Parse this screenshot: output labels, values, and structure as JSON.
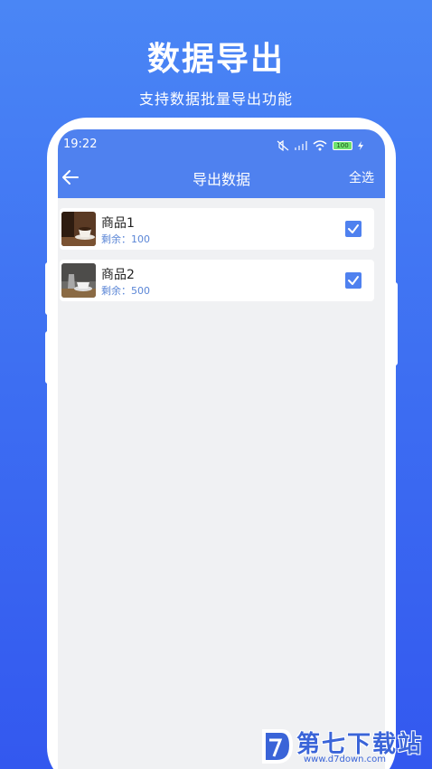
{
  "promo": {
    "title": "数据导出",
    "subtitle": "支持数据批量导出功能"
  },
  "status_bar": {
    "time": "19:22",
    "battery": "100"
  },
  "app_bar": {
    "back_icon": "arrow-left-icon",
    "title": "导出数据",
    "select_all": "全选"
  },
  "items": [
    {
      "name": "商品1",
      "stock": "剩余：100",
      "checked": true
    },
    {
      "name": "商品2",
      "stock": "剩余：500",
      "checked": true
    }
  ],
  "watermark": {
    "text": "第七下载站",
    "url": "www.d7down.com"
  },
  "colors": {
    "background": "#3d6ef2",
    "app_bar": "#4f81ef",
    "checkbox": "#4f81ef",
    "stock_text": "#5b86d6"
  }
}
